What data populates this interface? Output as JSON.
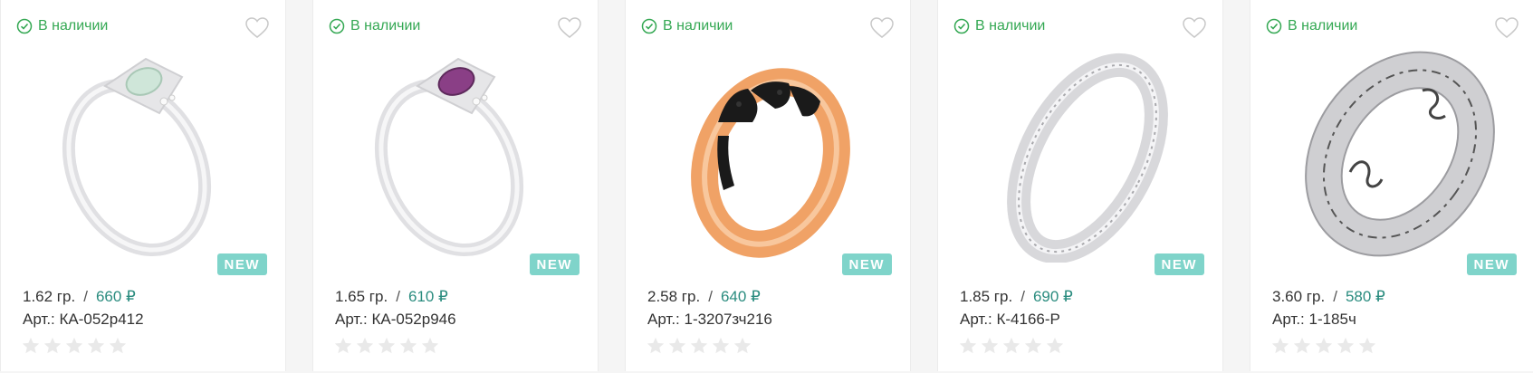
{
  "products": [
    {
      "stock_label": "В наличии",
      "weight": "1.62 гр.",
      "separator": "/",
      "price": "660 ₽",
      "article": "Арт.: КА-052р412",
      "badge": "NEW",
      "rating": 0,
      "image": "ring-with-pale-green-stone",
      "metal_color": "#d9d9dc",
      "stone_color": "#cfe6d9"
    },
    {
      "stock_label": "В наличии",
      "weight": "1.65 гр.",
      "separator": "/",
      "price": "610 ₽",
      "article": "Арт.: КА-052р946",
      "badge": "NEW",
      "rating": 0,
      "image": "ring-with-purple-stone",
      "metal_color": "#d9d9dc",
      "stone_color": "#8a3f86"
    },
    {
      "stock_label": "В наличии",
      "weight": "2.58 гр.",
      "separator": "/",
      "price": "640 ₽",
      "article": "Арт.: 1-3207зч216",
      "badge": "NEW",
      "rating": 0,
      "image": "gold-ring-with-black-elephants",
      "metal_color": "#f0a266",
      "stone_color": "#1a1a1a"
    },
    {
      "stock_label": "В наличии",
      "weight": "1.85 гр.",
      "separator": "/",
      "price": "690 ₽",
      "article": "Арт.: К-4166-Р",
      "badge": "NEW",
      "rating": 0,
      "image": "silver-band-ring-with-engraving",
      "metal_color": "#d8d8db",
      "stone_color": "#bdbdbd"
    },
    {
      "stock_label": "В наличии",
      "weight": "3.60 гр.",
      "separator": "/",
      "price": "580 ₽",
      "article": "Арт.: 1-185ч",
      "badge": "NEW",
      "rating": 0,
      "image": "oxidized-silver-ring-with-swirl-pattern",
      "metal_color": "#cfcfd2",
      "stone_color": "#444444"
    }
  ],
  "colors": {
    "in_stock": "#34a853",
    "price": "#2a8c7f",
    "badge_bg": "#7fd4ca",
    "star_empty": "#e9e9e9"
  }
}
